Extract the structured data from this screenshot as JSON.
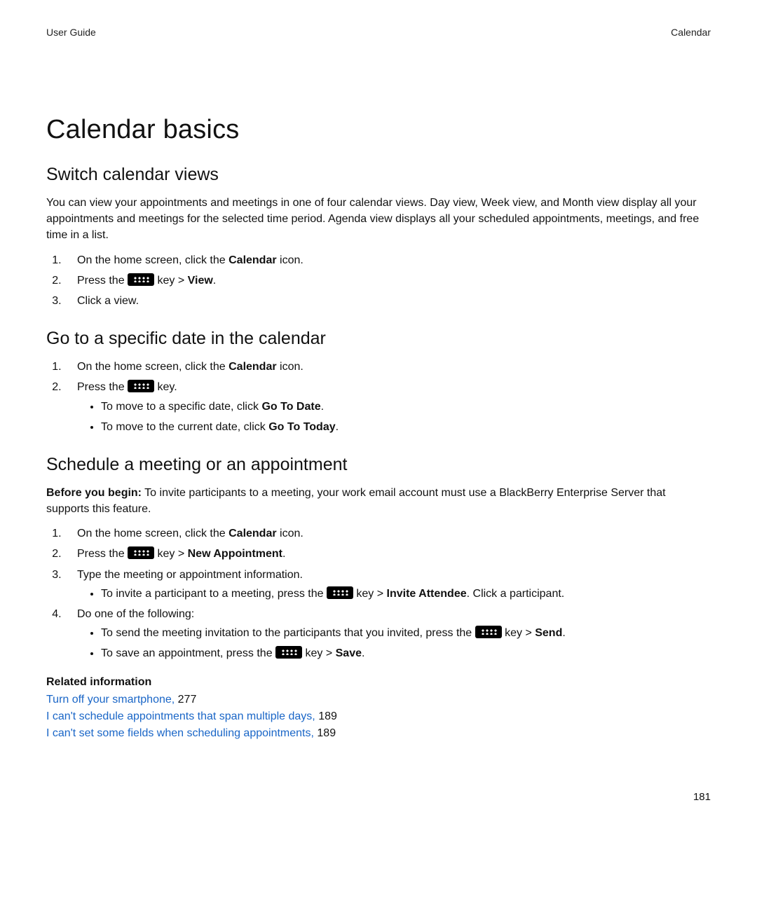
{
  "header": {
    "left": "User Guide",
    "right": "Calendar"
  },
  "title": "Calendar basics",
  "sections": {
    "switch_views": {
      "heading": "Switch calendar views",
      "intro": "You can view your appointments and meetings in one of four calendar views. Day view, Week view, and Month view display all your appointments and meetings for the selected time period. Agenda view displays all your scheduled appointments, meetings, and free time in a list.",
      "steps": {
        "s1_pre": "On the home screen, click the ",
        "s1_bold": "Calendar",
        "s1_post": " icon.",
        "s2_pre": "Press the ",
        "s2_mid": " key > ",
        "s2_bold": "View",
        "s2_post": ".",
        "s3": "Click a view."
      }
    },
    "goto_date": {
      "heading": "Go to a specific date in the calendar",
      "steps": {
        "s1_pre": "On the home screen, click the ",
        "s1_bold": "Calendar",
        "s1_post": " icon.",
        "s2_pre": "Press the ",
        "s2_post": " key.",
        "b1_pre": "To move to a specific date, click ",
        "b1_bold": "Go To Date",
        "b1_post": ".",
        "b2_pre": "To move to the current date, click ",
        "b2_bold": "Go To Today",
        "b2_post": "."
      }
    },
    "schedule": {
      "heading": "Schedule a meeting or an appointment",
      "before_label": "Before you begin:",
      "before_text": " To invite participants to a meeting, your work email account must use a BlackBerry Enterprise Server that supports this feature.",
      "steps": {
        "s1_pre": "On the home screen, click the ",
        "s1_bold": "Calendar",
        "s1_post": " icon.",
        "s2_pre": "Press the ",
        "s2_mid": " key > ",
        "s2_bold": "New Appointment",
        "s2_post": ".",
        "s3": "Type the meeting or appointment information.",
        "s3b1_pre": "To invite a participant to a meeting, press the ",
        "s3b1_mid": " key > ",
        "s3b1_bold": "Invite Attendee",
        "s3b1_post": ". Click a participant.",
        "s4": "Do one of the following:",
        "s4b1_pre": "To send the meeting invitation to the participants that you invited, press the ",
        "s4b1_mid": " key > ",
        "s4b1_bold": "Send",
        "s4b1_post": ".",
        "s4b2_pre": "To save an appointment, press the ",
        "s4b2_mid": " key > ",
        "s4b2_bold": "Save",
        "s4b2_post": "."
      }
    }
  },
  "related": {
    "heading": "Related information",
    "links": [
      {
        "text": "Turn off your smartphone,",
        "page": "277"
      },
      {
        "text": "I can't schedule appointments that span multiple days,",
        "page": "189"
      },
      {
        "text": "I can't set some fields when scheduling appointments,",
        "page": "189"
      }
    ]
  },
  "page_number": "181"
}
